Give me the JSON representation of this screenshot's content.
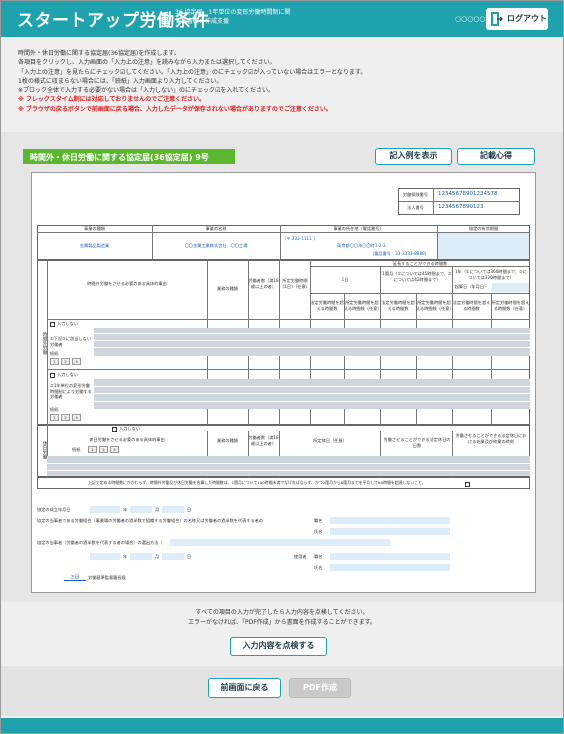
{
  "header": {
    "logo": "スタートアップ労働条件",
    "subtitle": "36 協定届、1年単位の変形労働時間制に関する書面の作成支援",
    "user_name": "○○○○○様",
    "logout_label": "ログアウト"
  },
  "instructions": {
    "lines": [
      "時間外・休日労働に関する協定届(36協定届)を作成します。",
      "各項目をクリックし、入力画面の「入力上の注意」を読みながら入力または選択してください。",
      "「入力上の注意」を見たらにチェック☑してください。「入力上の注意」のにチェック☑が入っていない場合はエラーとなります。",
      "1枚の様式に収まらない場合には、「続紙」入力画面より入力してください。",
      "※ブロック全体で入力する必要がない場合は「入力しない」のにチェック☑を入れてください。"
    ],
    "warnings": [
      "※ フレックスタイム制には対応しておりませんのでご注意ください。",
      "※ ブラウザの戻るボタンで前画面に戻る場合、入力したデータが保存されない場合がありますのでご注意ください。"
    ]
  },
  "form": {
    "title": "時間外・休日労働に関する協定届(36協定届) 9号",
    "example_button": "記入例を表示",
    "tips_button": "記載心得"
  },
  "doc": {
    "insurance_label": "労働保険番号",
    "insurance_number": "12345678901234578",
    "corp_label": "法人番号",
    "corp_number": "1234567890123",
    "col_business_type": "事業の種類",
    "col_business_name": "事業の名称",
    "col_location": "事業の所在地（電話番号）",
    "col_period": "協定の有効期間",
    "business_type": "金属製品製造業",
    "business_name": "〇〇金属工業株式会社　〇〇工場",
    "zip": "（〒 333-1111 ）",
    "address": "東京都〇〇市〇〇町1-2-3",
    "phone": "（電話番号：33-3333-8888）",
    "h_reason": "時間外労働をさせる必要のある具体的事由",
    "h_job": "業務の種類",
    "h_workers": "労働者数（満18歳以上の者）",
    "h_legal": "所定労働時間（1日）（任意）",
    "h_extendable": "延長することができる時間数",
    "h_1day": "1日",
    "h_1month": "1箇月（①については45時間まで、②については42時間まで）",
    "h_1year": "1年（①については360時間まで、②については320時間まで）",
    "h_startdate": "起算日（年月日）",
    "h_exceed_legal": "法定労働時間を超える時間数",
    "h_exceed_prescribed": "所定労働時間を超える時間数（任意）",
    "overtime_side": "時間外労働",
    "no_input": "入力しない",
    "row1_label": "①下記②に該当しない労働者",
    "row2_label": "②1年単位の変形労働時間制により労働する労働者",
    "continuation_label": "続紙",
    "page_buttons": [
      "1",
      "2",
      "3"
    ],
    "holiday_side": "休日労働",
    "hol_reason": "休日労働をさせる必要のある具体的事由",
    "hol_job": "業務の種類",
    "hol_workers": "労働者数（満18歳以上の者）",
    "hol_prescribed": "所定休日（任意）",
    "hol_days": "労働させることができる法定休日の日数",
    "hol_hours": "労働させることができる法定休日における始業及び終業の時刻",
    "pledge": "上記で定める時間数にかかわらず、時間外労働及び休日労働を合算した時間数は、1箇月について100時間未満でなければならず、かつ2箇月から6箇月までを平均して80時間を超過しないこと。",
    "date_label": "協定の成立年月日",
    "year": "年",
    "month": "月",
    "day": "日",
    "union_label": "協定の当事者である労働組合（事業場の労働者の過半数で組織する労働組合）の名称又は労働者の過半数を代表する者の",
    "title_label": "職名",
    "name_label": "氏名",
    "elect_label": "協定の当事者（労働者の過半数を代表する者の場合）の選出方法（",
    "employer_label": "使用者",
    "office_name": "三田",
    "office_suffix": "労働基準監督署長殿"
  },
  "bottom": {
    "check_msg_1": "すべての項目の入力が完了したら入力内容を点検してください。",
    "check_msg_2": "エラーがなければ、「PDF作成」から書面を作成することができます。",
    "check_button": "入力内容を点検する",
    "back_button": "前画面に戻る",
    "pdf_button": "PDF作成"
  },
  "colors": {
    "accent": "#1ea2ad",
    "green": "#5bb82e",
    "warning": "#e02020"
  },
  "icons": {
    "logout": "logout-door-icon"
  }
}
